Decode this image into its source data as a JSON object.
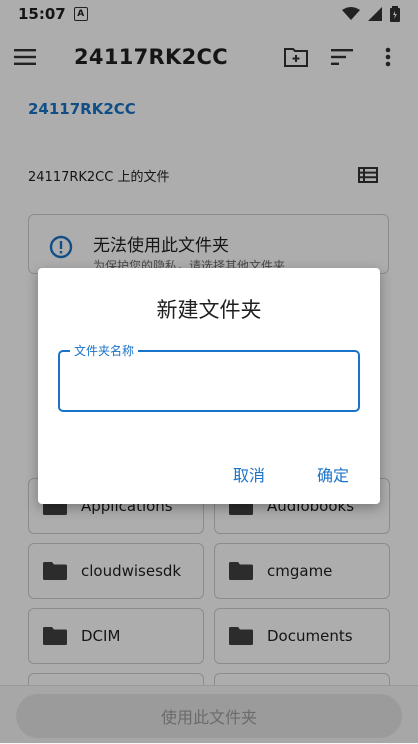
{
  "status_bar": {
    "time": "15:07",
    "notif_icon": "A"
  },
  "app_bar": {
    "title": "24117RK2CC"
  },
  "breadcrumb": "24117RK2CC",
  "section": {
    "label": "24117RK2CC 上的文件"
  },
  "warning": {
    "title": "无法使用此文件夹",
    "subtitle": "为保护您的隐私，请选择其他文件夹"
  },
  "folders": [
    "Applications",
    "Audiobooks",
    "cloudwisesdk",
    "cmgame",
    "DCIM",
    "Documents"
  ],
  "bottom": {
    "use_folder_label": "使用此文件夹"
  },
  "dialog": {
    "title": "新建文件夹",
    "field_label": "文件夹名称",
    "field_value": "",
    "cancel_label": "取消",
    "confirm_label": "确定"
  },
  "colors": {
    "accent": "#1a73c8"
  }
}
